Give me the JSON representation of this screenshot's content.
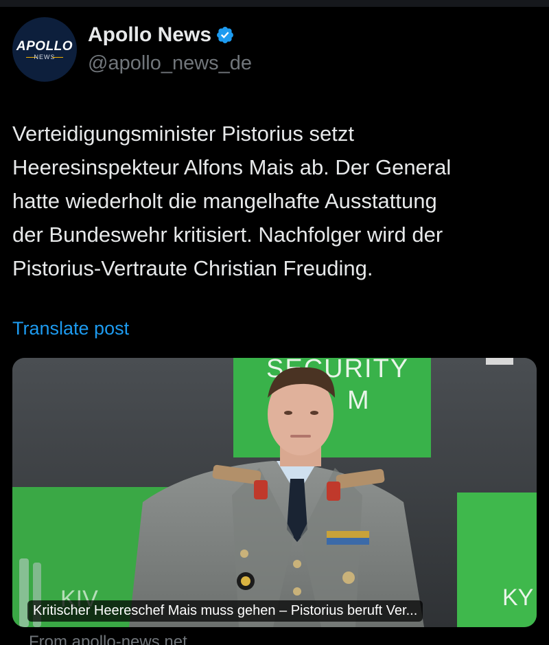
{
  "account": {
    "display_name": "Apollo News",
    "handle": "@apollo_news_de",
    "verified": true,
    "avatar": {
      "word": "APOLLO",
      "sub": "NEWS"
    }
  },
  "post": {
    "text": "Verteidigungsminister Pistorius setzt\nHeeresinspekteur Alfons Mais ab. Der General\nhatte wiederholt die mangelhafte Ausstattung\nder Bundeswehr kritisiert. Nachfolger wird der\nPistorius-Vertraute Christian Freuding.",
    "translate_label": "Translate post"
  },
  "media": {
    "background_sign_text_1": "SECURITY",
    "background_sign_text_2": "M",
    "caption": "Kritischer Heereschef Mais muss gehen – Pistorius beruft Ver...",
    "source": "From apollo-news.net"
  },
  "colors": {
    "background": "#000000",
    "text": "#e7e9ea",
    "muted": "#71767b",
    "link": "#1d9bf0",
    "verified": "#1d9bf0"
  }
}
